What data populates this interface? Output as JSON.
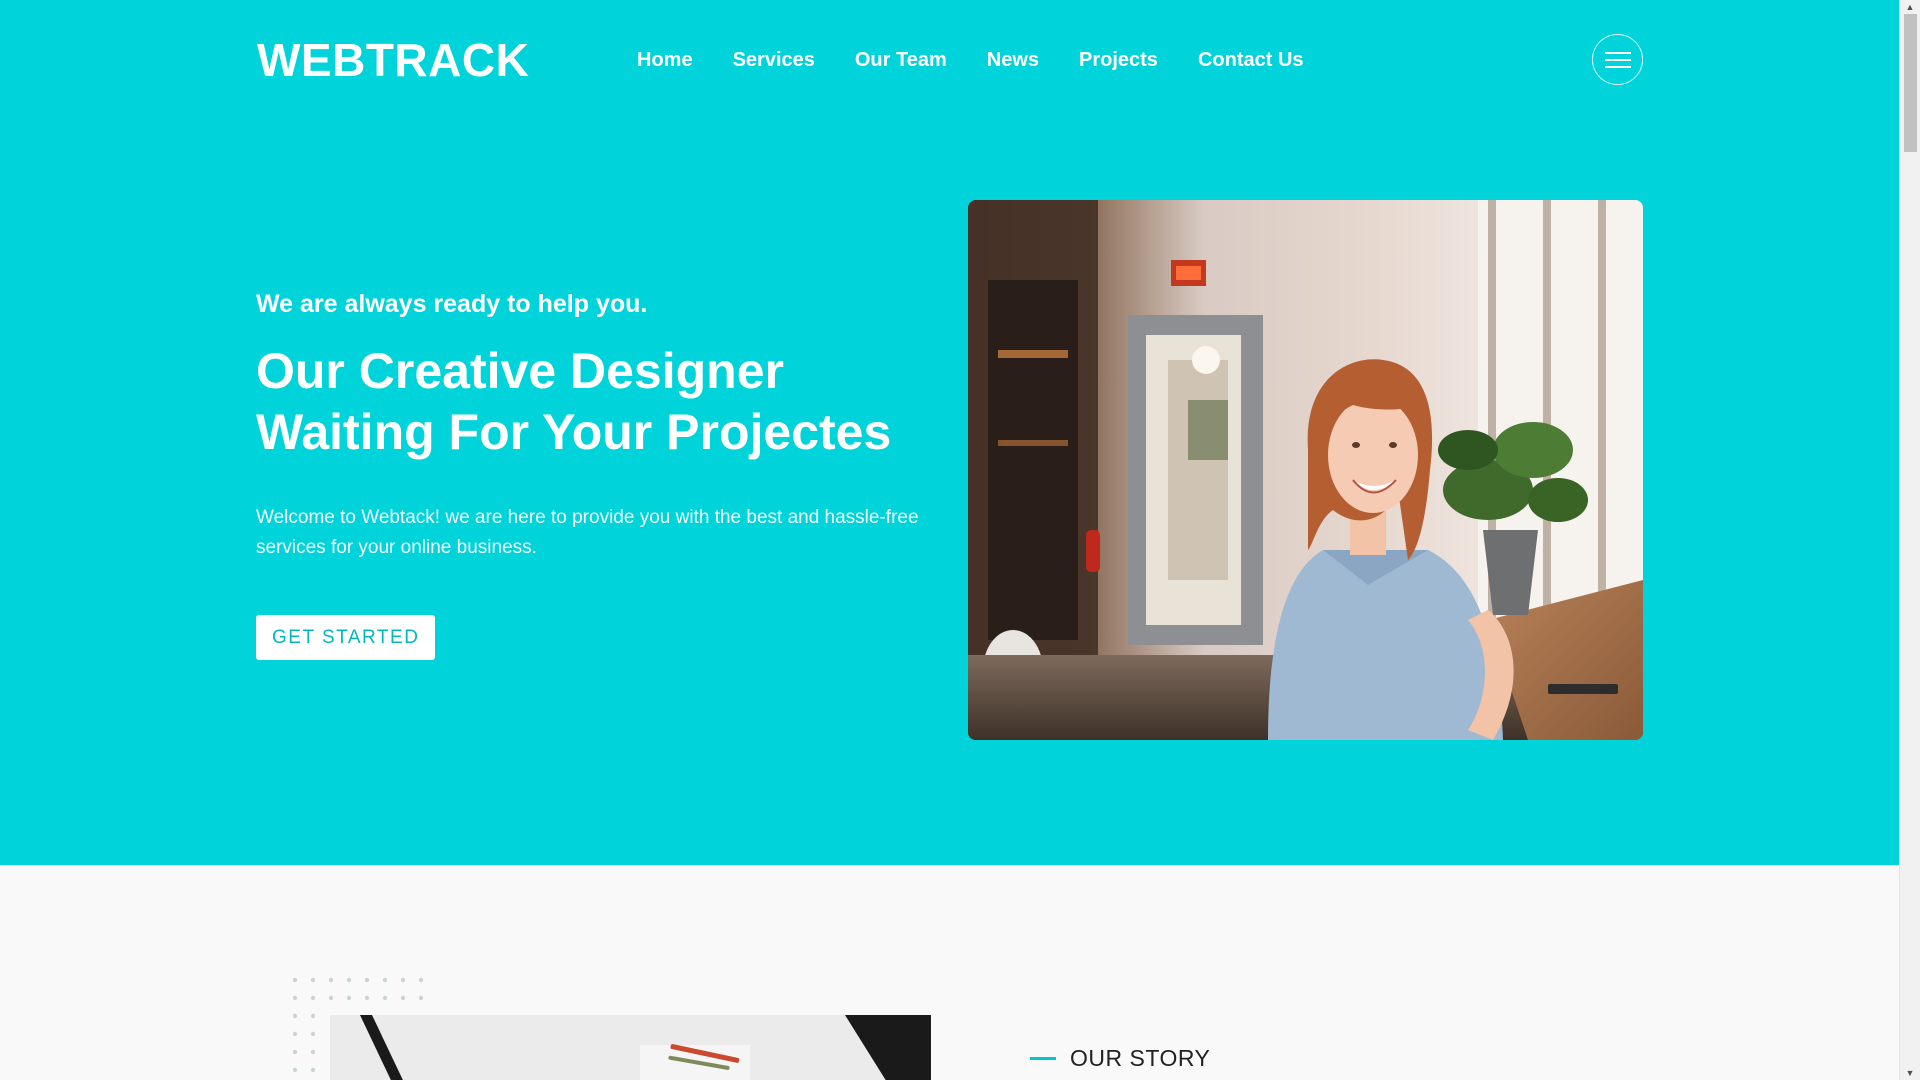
{
  "brand": {
    "logo": "WEBTRACK"
  },
  "nav": {
    "items": [
      "Home",
      "Services",
      "Our Team",
      "News",
      "Projects",
      "Contact Us"
    ]
  },
  "hero": {
    "tagline": "We are always ready to help you.",
    "headline_line1": "Our Creative Designer",
    "headline_line2": "Waiting For Your Projectes",
    "intro": "Welcome to Webtack! we are here to provide you with the best and hassle-free services for your online business.",
    "cta_label": "GET STARTED"
  },
  "story": {
    "label": "OUR STORY"
  },
  "colors": {
    "accent": "#00d3d9",
    "page_bg": "#f9f9f9",
    "cta_text": "#00b8be"
  },
  "icons": [
    "hamburger-menu-icon"
  ]
}
